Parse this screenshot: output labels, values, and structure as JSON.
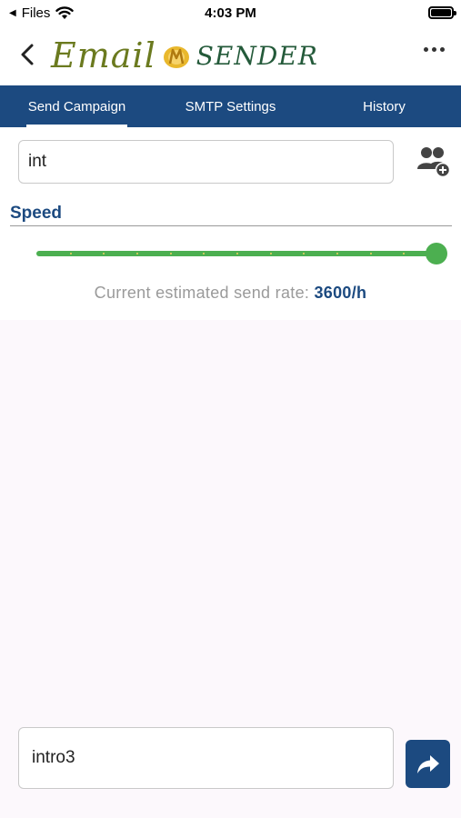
{
  "status_bar": {
    "back_app": "Files",
    "time": "4:03 PM"
  },
  "header": {
    "logo_word_1": "Email",
    "logo_word_2": "SENDER"
  },
  "tabs": [
    {
      "label": "Send Campaign",
      "active": true
    },
    {
      "label": "SMTP Settings",
      "active": false
    },
    {
      "label": "History",
      "active": false
    }
  ],
  "recipients": {
    "value": "int"
  },
  "speed": {
    "label": "Speed",
    "level": 1.0,
    "tick_count": 12
  },
  "rate": {
    "prefix": "Current estimated send rate: ",
    "value": "3600/h"
  },
  "message": {
    "value": "intro3"
  },
  "colors": {
    "primary": "#1c4a80",
    "slider": "#4caf50",
    "background": "#fcf8fc"
  },
  "icons": {
    "back": "chevron-left-icon",
    "more": "more-horizontal-icon",
    "add_group": "add-group-icon",
    "send": "share-arrow-icon"
  }
}
